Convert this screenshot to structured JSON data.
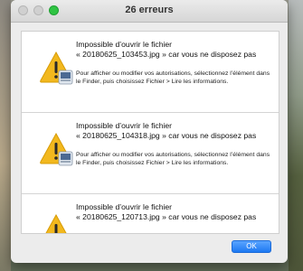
{
  "window": {
    "title": "26 erreurs"
  },
  "errors": [
    {
      "heading_line1": "Impossible d’ouvrir le fichier",
      "heading_line2": "« 20180625_103453.jpg » car vous ne disposez pas",
      "detail": "Pour afficher ou modifier vos autorisations, sélectionnez l’élément dans le Finder, puis choisissez Fichier > Lire les informations."
    },
    {
      "heading_line1": "Impossible d’ouvrir le fichier",
      "heading_line2": "« 20180625_104318.jpg » car vous ne disposez pas",
      "detail": "Pour afficher ou modifier vos autorisations, sélectionnez l’élément dans le Finder, puis choisissez Fichier > Lire les informations."
    },
    {
      "heading_line1": "Impossible d’ouvrir le fichier",
      "heading_line2": "« 20180625_120713.jpg » car vous ne disposez pas",
      "detail": ""
    }
  ],
  "buttons": {
    "ok_label": "OK"
  },
  "colors": {
    "accent": "#1d79f2",
    "warning": "#f2b81e"
  },
  "icons": {
    "entry_icon": "warning-triangle-icon"
  }
}
